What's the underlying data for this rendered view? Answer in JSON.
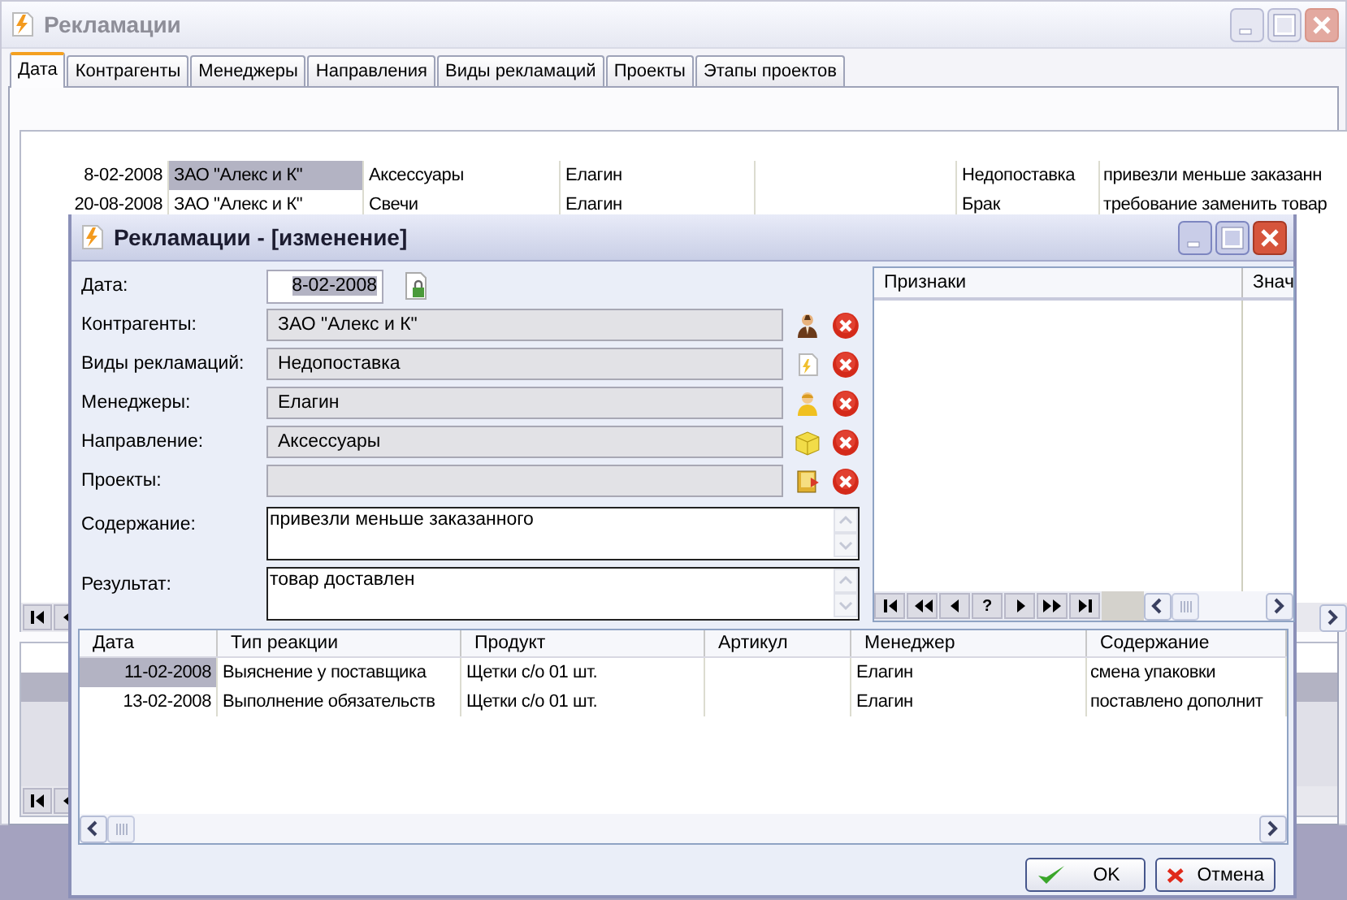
{
  "main_window": {
    "title": "Рекламации",
    "tabs": [
      {
        "label": "Дата",
        "selected": true
      },
      {
        "label": "Контрагенты",
        "selected": false
      },
      {
        "label": "Менеджеры",
        "selected": false
      },
      {
        "label": "Направления",
        "selected": false
      },
      {
        "label": "Виды рекламаций",
        "selected": false
      },
      {
        "label": "Проекты",
        "selected": false
      },
      {
        "label": "Этапы проектов",
        "selected": false
      }
    ],
    "grid": {
      "rows": [
        {
          "cells": [
            {
              "text": "8-02-2008",
              "selected": false
            },
            {
              "text": "ЗАО \"Алекс и К\"",
              "selected": true
            },
            {
              "text": "Аксессуары",
              "selected": false
            },
            {
              "text": "Елагин",
              "selected": false
            },
            {
              "selected": false
            },
            {
              "text": "Недопоставка",
              "selected": false
            },
            {
              "text": "привезли меньше заказанн",
              "selected": false
            }
          ]
        },
        {
          "cells": [
            {
              "text": "20-08-2008",
              "selected": false
            },
            {
              "text": "ЗАО \"Алекс и К\"",
              "selected": false
            },
            {
              "text": "Свечи",
              "selected": false
            },
            {
              "text": "Елагин",
              "selected": false
            },
            {
              "selected": false
            },
            {
              "text": "Брак",
              "selected": false
            },
            {
              "text": "требование заменить товар",
              "selected": false
            }
          ]
        }
      ]
    },
    "detail_grid": {
      "rows": [
        {
          "selected": true
        }
      ]
    }
  },
  "dialog": {
    "title": "Рекламации - [изменение]",
    "fields": [
      {
        "kind": "date",
        "label": "Дата:",
        "value": "8-02-2008"
      },
      {
        "kind": "lookup",
        "label": "Контрагенты:",
        "value": "ЗАО \"Алекс и К\""
      },
      {
        "kind": "lookup",
        "label": "Виды рекламаций:",
        "value": "Недопоставка"
      },
      {
        "kind": "lookup",
        "label": "Менеджеры:",
        "value": "Елагин"
      },
      {
        "kind": "lookup",
        "label": "Направление:",
        "value": "Аксессуары"
      },
      {
        "kind": "lookup",
        "label": "Проекты:"
      },
      {
        "kind": "memo",
        "label": "Содержание:",
        "value": "привезли меньше заказанного"
      },
      {
        "kind": "memo",
        "label": "Результат:",
        "value": "товар доставлен"
      }
    ],
    "attributes_grid": {
      "columns": [
        "Признаки",
        "Знач"
      ],
      "navigator_help": "?"
    },
    "history": {
      "columns": [
        "Дата",
        "Тип реакции",
        "Продукт",
        "Артикул",
        "Менеджер",
        "Содержание"
      ],
      "rows": [
        {
          "cells": [
            {
              "text": "11-02-2008",
              "selected": true
            },
            {
              "text": "Выяснение у поставщика",
              "selected": false
            },
            {
              "text": "Щетки с/о 01 шт.",
              "selected": false
            },
            {
              "selected": false
            },
            {
              "text": "Елагин",
              "selected": false
            },
            {
              "text": "смена упаковки",
              "selected": false
            }
          ]
        },
        {
          "cells": [
            {
              "text": "13-02-2008",
              "selected": false
            },
            {
              "text": "Выполнение обязательств",
              "selected": false
            },
            {
              "text": "Щетки с/о 01 шт.",
              "selected": false
            },
            {
              "selected": false
            },
            {
              "text": "Елагин",
              "selected": false
            },
            {
              "text": "поставлено дополнит",
              "selected": false
            }
          ]
        }
      ]
    },
    "buttons": [
      {
        "kind": "ok",
        "label": "OK"
      },
      {
        "kind": "cancel",
        "label": "Отмена"
      }
    ]
  }
}
